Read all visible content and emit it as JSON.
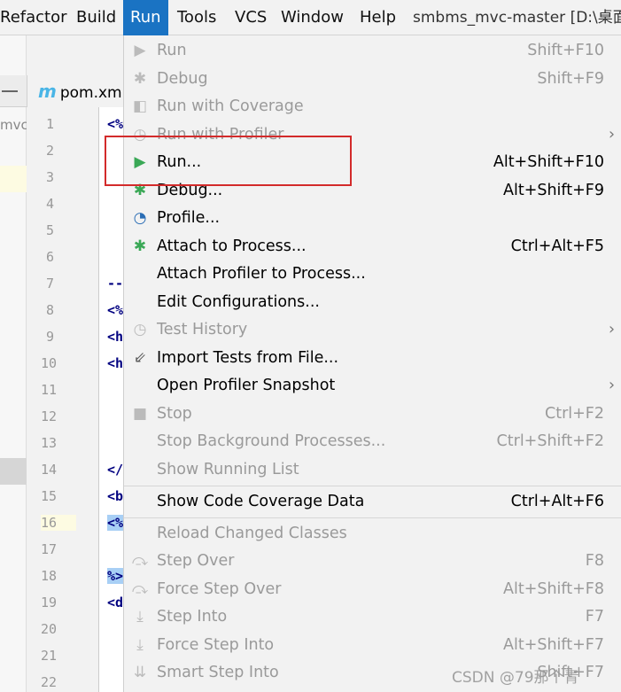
{
  "menubar": {
    "items": [
      "Refactor",
      "Build",
      "Run",
      "Tools",
      "VCS",
      "Window",
      "Help"
    ],
    "active": "Run",
    "title": "smbms_mvc-master [D:\\桌面"
  },
  "editor": {
    "tab_label": "pom.xm",
    "tab_icon": "m",
    "project_fragment": "mvc-",
    "line_numbers": [
      "1",
      "2",
      "3",
      "4",
      "5",
      "6",
      "7",
      "8",
      "9",
      "10",
      "11",
      "12",
      "13",
      "14",
      "15",
      "16",
      "17",
      "18",
      "19",
      "20",
      "21",
      "22"
    ],
    "code_fragments": {
      "1": "<%",
      "7": "--",
      "8": "<%",
      "9": "<h",
      "10": "<h",
      "14": "</",
      "15": "<b",
      "16": "<%",
      "18": "%>",
      "19": "<d"
    }
  },
  "run_menu": {
    "items": [
      {
        "label": "Run",
        "shortcut": "Shift+F10",
        "icon": "play-icon",
        "enabled": false
      },
      {
        "label": "Debug",
        "shortcut": "Shift+F9",
        "icon": "bug-icon",
        "enabled": false
      },
      {
        "label": "Run with Coverage",
        "shortcut": "",
        "icon": "coverage-icon",
        "enabled": false
      },
      {
        "label": "Run with Profiler",
        "shortcut": "",
        "icon": "profiler-icon",
        "enabled": false,
        "submenu": true
      },
      {
        "label": "Run...",
        "shortcut": "Alt+Shift+F10",
        "icon": "play-icon",
        "enabled": true
      },
      {
        "label": "Debug...",
        "shortcut": "Alt+Shift+F9",
        "icon": "bug-icon",
        "enabled": true
      },
      {
        "label": "Profile...",
        "shortcut": "",
        "icon": "gauge-icon",
        "enabled": true
      },
      {
        "label": "Attach to Process...",
        "shortcut": "Ctrl+Alt+F5",
        "icon": "attach-bug-icon",
        "enabled": true
      },
      {
        "label": "Attach Profiler to Process...",
        "shortcut": "",
        "icon": "",
        "enabled": true
      },
      {
        "label": "Edit Configurations...",
        "shortcut": "",
        "icon": "",
        "enabled": true
      },
      {
        "label": "Test History",
        "shortcut": "",
        "icon": "clock-icon",
        "enabled": false,
        "submenu": true
      },
      {
        "label": "Import Tests from File...",
        "shortcut": "",
        "icon": "import-icon",
        "enabled": true
      },
      {
        "label": "Open Profiler Snapshot",
        "shortcut": "",
        "icon": "",
        "enabled": true,
        "submenu": true
      },
      {
        "label": "Stop",
        "shortcut": "Ctrl+F2",
        "icon": "stop-icon",
        "enabled": false
      },
      {
        "label": "Stop Background Processes...",
        "shortcut": "Ctrl+Shift+F2",
        "icon": "",
        "enabled": false
      },
      {
        "label": "Show Running List",
        "shortcut": "",
        "icon": "",
        "enabled": false,
        "separator_after": true
      },
      {
        "label": "Show Code Coverage Data",
        "shortcut": "Ctrl+Alt+F6",
        "icon": "",
        "enabled": true,
        "separator_after": true
      },
      {
        "label": "Reload Changed Classes",
        "shortcut": "",
        "icon": "",
        "enabled": false
      },
      {
        "label": "Step Over",
        "shortcut": "F8",
        "icon": "step-over-icon",
        "enabled": false
      },
      {
        "label": "Force Step Over",
        "shortcut": "Alt+Shift+F8",
        "icon": "step-over-icon",
        "enabled": false
      },
      {
        "label": "Step Into",
        "shortcut": "F7",
        "icon": "step-into-icon",
        "enabled": false
      },
      {
        "label": "Force Step Into",
        "shortcut": "Alt+Shift+F7",
        "icon": "step-into-icon",
        "enabled": false
      },
      {
        "label": "Smart Step Into",
        "shortcut": "Shift+F7",
        "icon": "smart-step-into-icon",
        "enabled": false
      }
    ]
  },
  "colors": {
    "menu_active": "#1a73c3",
    "highlight_box": "#d32b2b",
    "run_green": "#3aa856"
  },
  "watermark": "CSDN @79那个青"
}
